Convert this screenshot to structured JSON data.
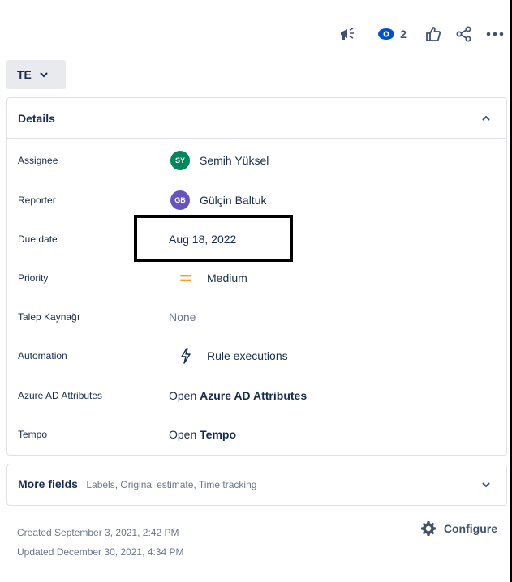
{
  "toolbar": {
    "watch_count": "2",
    "icons": [
      "megaphone-icon",
      "eye-icon",
      "thumbs-up-icon",
      "share-icon",
      "more-icon"
    ]
  },
  "chip": {
    "label": "TE"
  },
  "details": {
    "title": "Details",
    "fields": {
      "assignee": {
        "label": "Assignee",
        "initials": "SY",
        "name": "Semih Yüksel",
        "avatar_color": "#00875a"
      },
      "reporter": {
        "label": "Reporter",
        "initials": "GB",
        "name": "Gülçin Baltuk",
        "avatar_color": "#6554c0"
      },
      "due_date": {
        "label": "Due date",
        "value": "Aug 18, 2022"
      },
      "priority": {
        "label": "Priority",
        "value": "Medium",
        "color": "#ff991f"
      },
      "talep": {
        "label": "Talep Kaynağı",
        "value": "None"
      },
      "automation": {
        "label": "Automation",
        "value": "Rule executions"
      },
      "azure": {
        "label": "Azure AD Attributes",
        "prefix": "Open",
        "value": "Azure AD Attributes"
      },
      "tempo": {
        "label": "Tempo",
        "prefix": "Open",
        "value": "Tempo"
      }
    }
  },
  "more_fields": {
    "title": "More fields",
    "subtitle": "Labels, Original estimate, Time tracking"
  },
  "footer": {
    "created": "Created September 3, 2021, 2:42 PM",
    "updated": "Updated December 30, 2021, 4:34 PM",
    "configure_label": "Configure"
  }
}
